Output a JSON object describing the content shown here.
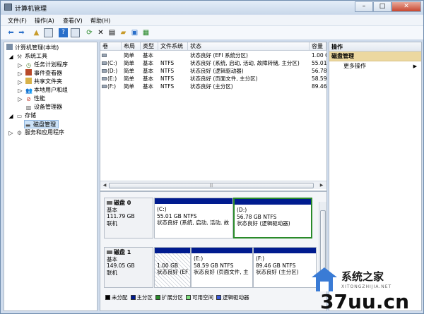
{
  "window": {
    "title": "计算机管理",
    "btn_min": "–",
    "btn_max": "□",
    "btn_close": "✕"
  },
  "menu": [
    "文件(F)",
    "操作(A)",
    "查看(V)",
    "帮助(H)"
  ],
  "toolbar_icons": [
    "back-arrow",
    "forward-arrow",
    "up-folder",
    "show-hide-tree",
    "help",
    "show-hide-action",
    "refresh",
    "delete",
    "properties",
    "open",
    "save",
    "disk-settings"
  ],
  "tree": {
    "root": "计算机管理(本地)",
    "system_tools": "系统工具",
    "task_scheduler": "任务计划程序",
    "event_viewer": "事件查看器",
    "shared_folders": "共享文件夹",
    "local_users": "本地用户和组",
    "performance": "性能",
    "device_manager": "设备管理器",
    "storage": "存储",
    "disk_management": "磁盘管理",
    "services_apps": "服务和应用程序"
  },
  "volumes": {
    "headers": [
      "卷",
      "布局",
      "类型",
      "文件系统",
      "状态",
      "容量"
    ],
    "rows": [
      [
        "",
        "简单",
        "基本",
        "",
        "状态良好 (EFI 系统分区)",
        "1.00 C"
      ],
      [
        "(C:)",
        "简单",
        "基本",
        "NTFS",
        "状态良好 (系统, 启动, 活动, 故障转储, 主分区)",
        "55.01"
      ],
      [
        "(D:)",
        "简单",
        "基本",
        "NTFS",
        "状态良好 (逻辑驱动器)",
        "56.78"
      ],
      [
        "(E:)",
        "简单",
        "基本",
        "NTFS",
        "状态良好 (页面文件, 主分区)",
        "58.59"
      ],
      [
        "(F:)",
        "简单",
        "基本",
        "NTFS",
        "状态良好 (主分区)",
        "89.46"
      ]
    ],
    "scroll_mid": "|||"
  },
  "disks": [
    {
      "name": "磁盘 0",
      "type": "基本",
      "size": "111.79 GB",
      "state": "联机",
      "partitions": [
        {
          "label": "(C:)",
          "size": "55.01 GB NTFS",
          "status": "状态良好 (系统, 启动, 活动, 故",
          "bar_color": "#001b8f"
        },
        {
          "label": "(D:)",
          "size": "56.78 GB NTFS",
          "status": "状态良好 (逻辑驱动器)",
          "bar_color": "#001b8f"
        }
      ]
    },
    {
      "name": "磁盘 1",
      "type": "基本",
      "size": "149.05 GB",
      "state": "联机",
      "partitions": [
        {
          "label": "",
          "size": "1.00 GB",
          "status": "状态良好 (EF",
          "bar_color": "#001b8f"
        },
        {
          "label": "(E:)",
          "size": "58.59 GB NTFS",
          "status": "状态良好 (页面文件, 主",
          "bar_color": "#001b8f"
        },
        {
          "label": "(F:)",
          "size": "89.46 GB NTFS",
          "status": "状态良好 (主分区)",
          "bar_color": "#001b8f"
        }
      ]
    }
  ],
  "legend": [
    {
      "label": "未分配",
      "color": "#000000"
    },
    {
      "label": "主分区",
      "color": "#001b8f"
    },
    {
      "label": "扩展分区",
      "color": "#2a8a2a"
    },
    {
      "label": "可用空间",
      "color": "#7fe07f"
    },
    {
      "label": "逻辑驱动器",
      "color": "#3b5bdb"
    }
  ],
  "actions": {
    "header": "操作",
    "section": "磁盘管理",
    "more": "更多操作",
    "more_arrow": "▶"
  },
  "watermark": {
    "brand": "系统之家",
    "site": "37uu.cn",
    "url": "XITONGZHIJIA.NET"
  }
}
